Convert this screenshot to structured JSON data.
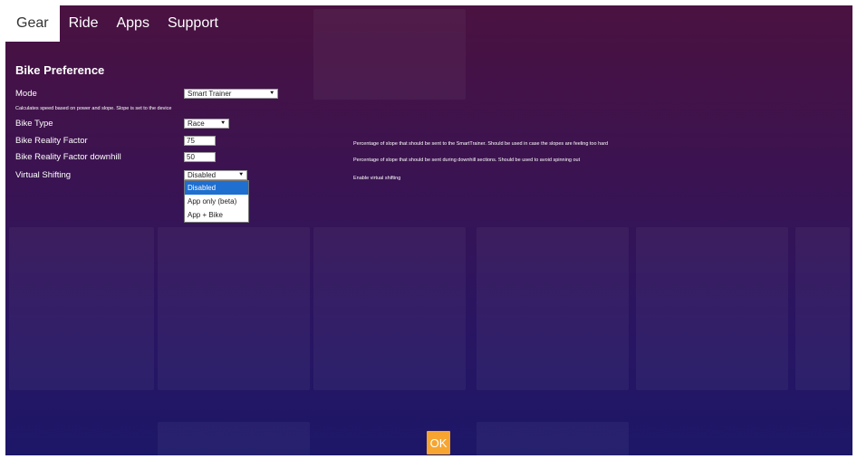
{
  "tabs": [
    {
      "label": "Gear",
      "active": true
    },
    {
      "label": "Ride",
      "active": false
    },
    {
      "label": "Apps",
      "active": false
    },
    {
      "label": "Support",
      "active": false
    }
  ],
  "section_title": "Bike Preference",
  "mode": {
    "label": "Mode",
    "value": "Smart Trainer",
    "hint": "Calculates speed based on power and slope. Slope is set to the device"
  },
  "bike_type": {
    "label": "Bike Type",
    "value": "Race"
  },
  "reality_factor": {
    "label": "Bike Reality Factor",
    "value": "75",
    "hint": "Percentage of slope that should be sent to the SmartTrainer. Should be used in case the slopes are feeling too hard"
  },
  "reality_factor_downhill": {
    "label": "Bike Reality Factor downhill",
    "value": "50",
    "hint": "Percentage of slope that should be sent during downhill sections. Should be used to avoid spinning out"
  },
  "virtual_shifting": {
    "label": "Virtual Shifting",
    "value": "Disabled",
    "hint": "Enable virtual shifting",
    "options": [
      "Disabled",
      "App only (beta)",
      "App + Bike"
    ],
    "selected_index": 0
  },
  "ok_label": "OK",
  "colors": {
    "accent": "#f7a530",
    "selection": "#1e6fd0",
    "background_top": "#4a1240",
    "background_bottom": "#1d1768"
  }
}
